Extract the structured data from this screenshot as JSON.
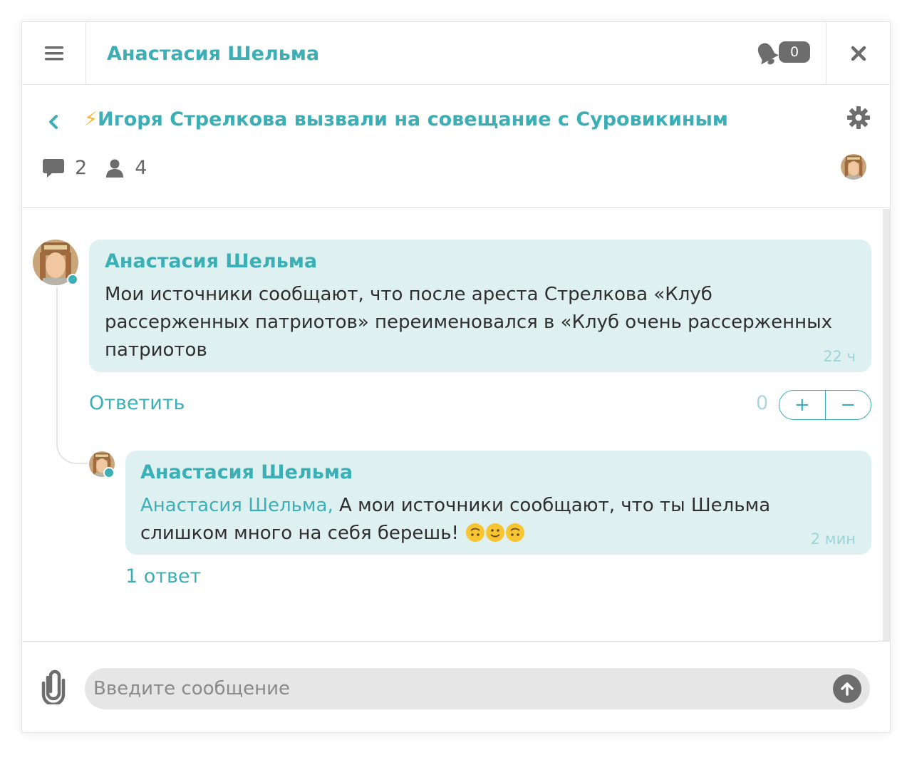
{
  "header": {
    "title": "Анастасия Шельма",
    "notifications_count": "0"
  },
  "topic": {
    "bolt": "⚡",
    "title": "Игоря Стрелкова вызвали на совещание с Суровикиным",
    "comments_count": "2",
    "participants_count": "4"
  },
  "messages": [
    {
      "author": "Анастасия Шельма",
      "text_lines": [
        "Мои источники сообщают, что после ареста Стрелкова «Клуб",
        "рассерженных патриотов» переименовался в «Клуб очень рассерженных",
        "патриотов"
      ],
      "time": "22 ч",
      "reply_label": "Ответить",
      "score": "0",
      "vote_plus": "+",
      "vote_minus": "−"
    },
    {
      "author": "Анастасия Шельма",
      "mention": "Анастасия Шельма,",
      "text_line1": " А мои источники сообщают, что ты Шельма",
      "text_line2": "слишком много на себя берешь!",
      "time": "2 мин",
      "answers_label": "1 ответ"
    }
  ],
  "composer": {
    "placeholder": "Введите сообщение"
  },
  "colors": {
    "accent": "#3bafb5",
    "bubble": "#dff0f1",
    "badge": "#6d6d6d"
  },
  "icons": [
    "menu-icon",
    "bell-icon",
    "close-icon",
    "back-chevron-icon",
    "gear-icon",
    "comment-icon",
    "user-icon",
    "paperclip-icon",
    "send-arrow-icon"
  ]
}
